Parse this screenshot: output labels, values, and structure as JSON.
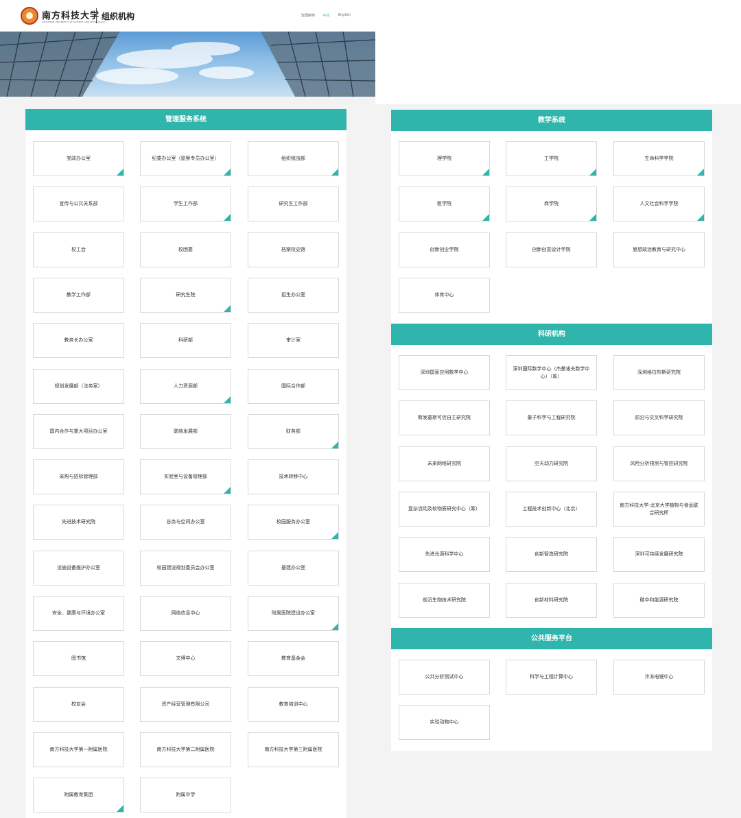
{
  "header": {
    "school_name": "南方科技大学",
    "school_name_en": "SOUTHERN UNIVERSITY OF SCIENCE AND TECHNOLOGY",
    "page_title": "组织机构",
    "nav": [
      "治理架构",
      "中文",
      "English"
    ]
  },
  "sections": [
    {
      "id": "left",
      "title": "管理服务系统",
      "items": [
        {
          "label": "党政办公室",
          "corner": true
        },
        {
          "label": "纪委办公室（监察专员办公室）",
          "corner": true
        },
        {
          "label": "组织统战部",
          "corner": true
        },
        {
          "label": "宣传与公共关系部",
          "corner": false
        },
        {
          "label": "学生工作部",
          "corner": true
        },
        {
          "label": "研究生工作部",
          "corner": false
        },
        {
          "label": "校工会",
          "corner": false
        },
        {
          "label": "校团委",
          "corner": false
        },
        {
          "label": "档案校史馆",
          "corner": false
        },
        {
          "label": "教学工作部",
          "corner": false
        },
        {
          "label": "研究生院",
          "corner": true
        },
        {
          "label": "招生办公室",
          "corner": false
        },
        {
          "label": "教务长办公室",
          "corner": false
        },
        {
          "label": "科研部",
          "corner": false
        },
        {
          "label": "审计室",
          "corner": false
        },
        {
          "label": "规划发展部（法务室）",
          "corner": false
        },
        {
          "label": "人力资源部",
          "corner": true
        },
        {
          "label": "国际合作部",
          "corner": false
        },
        {
          "label": "国内合作与重大项目办公室",
          "corner": false
        },
        {
          "label": "联络发展部",
          "corner": false
        },
        {
          "label": "财务部",
          "corner": true
        },
        {
          "label": "采购与招标管理部",
          "corner": false
        },
        {
          "label": "实验室与设备管理部",
          "corner": true
        },
        {
          "label": "技术转移中心",
          "corner": false
        },
        {
          "label": "先进技术研究院",
          "corner": false
        },
        {
          "label": "总务与空间办公室",
          "corner": false
        },
        {
          "label": "校园服务办公室",
          "corner": true
        },
        {
          "label": "设施设备维护办公室",
          "corner": false
        },
        {
          "label": "校园建设规划委员会办公室",
          "corner": false
        },
        {
          "label": "基建办公室",
          "corner": false
        },
        {
          "label": "安全、健康与环境办公室",
          "corner": false
        },
        {
          "label": "网络信息中心",
          "corner": false
        },
        {
          "label": "附属医院建设办公室",
          "corner": true
        },
        {
          "label": "图书馆",
          "corner": false
        },
        {
          "label": "文博中心",
          "corner": false
        },
        {
          "label": "教育基金会",
          "corner": false
        },
        {
          "label": "校友会",
          "corner": false
        },
        {
          "label": "资产经营管理有限公司",
          "corner": false
        },
        {
          "label": "教育培训中心",
          "corner": false
        },
        {
          "label": "南方科技大学第一附属医院",
          "corner": false
        },
        {
          "label": "南方科技大学第二附属医院",
          "corner": false
        },
        {
          "label": "南方科技大学第三附属医院",
          "corner": false
        },
        {
          "label": "附属教育集团",
          "corner": true
        },
        {
          "label": "附属中学",
          "corner": false
        }
      ]
    },
    {
      "id": "teaching",
      "title": "教学系统",
      "items": [
        {
          "label": "理学院",
          "corner": true
        },
        {
          "label": "工学院",
          "corner": true
        },
        {
          "label": "生命科学学院",
          "corner": true
        },
        {
          "label": "医学院",
          "corner": true
        },
        {
          "label": "商学院",
          "corner": true
        },
        {
          "label": "人文社会科学学院",
          "corner": true
        },
        {
          "label": "创新创业学院",
          "corner": false
        },
        {
          "label": "创新创意设计学院",
          "corner": false
        },
        {
          "label": "思想政治教育与研究中心",
          "corner": false
        },
        {
          "label": "体育中心",
          "corner": false
        }
      ]
    },
    {
      "id": "research",
      "title": "科研机构",
      "items": [
        {
          "label": "深圳国家应用数学中心",
          "corner": false
        },
        {
          "label": "深圳国际数学中心（杰曼诺夫数学中心）（筹）",
          "corner": false
        },
        {
          "label": "深圳格拉布斯研究院",
          "corner": false
        },
        {
          "label": "斯发基斯可信自主研究院",
          "corner": false
        },
        {
          "label": "量子科学与工程研究院",
          "corner": false
        },
        {
          "label": "前沿与交叉科学研究院",
          "corner": false
        },
        {
          "label": "未来网络研究院",
          "corner": false
        },
        {
          "label": "空天动力研究院",
          "corner": false
        },
        {
          "label": "风险分析预测与管控研究院",
          "corner": false
        },
        {
          "label": "复杂流动及软物质研究中心（筹）",
          "corner": false
        },
        {
          "label": "工程技术创新中心（北京）",
          "corner": false
        },
        {
          "label": "南方科技大学-北京大学植物与食品联合研究所",
          "corner": false
        },
        {
          "label": "先进光源科学中心",
          "corner": false
        },
        {
          "label": "创新智造研究院",
          "corner": false
        },
        {
          "label": "深圳可持续发展研究院",
          "corner": false
        },
        {
          "label": "前沿生物技术研究院",
          "corner": false
        },
        {
          "label": "创新材料研究院",
          "corner": false
        },
        {
          "label": "碳中和能源研究院",
          "corner": false
        }
      ]
    },
    {
      "id": "public",
      "title": "公共服务平台",
      "items": [
        {
          "label": "公共分析测试中心",
          "corner": false
        },
        {
          "label": "科学与工程计算中心",
          "corner": false
        },
        {
          "label": "冷冻电镜中心",
          "corner": false
        },
        {
          "label": "实验动物中心",
          "corner": false
        }
      ]
    }
  ]
}
